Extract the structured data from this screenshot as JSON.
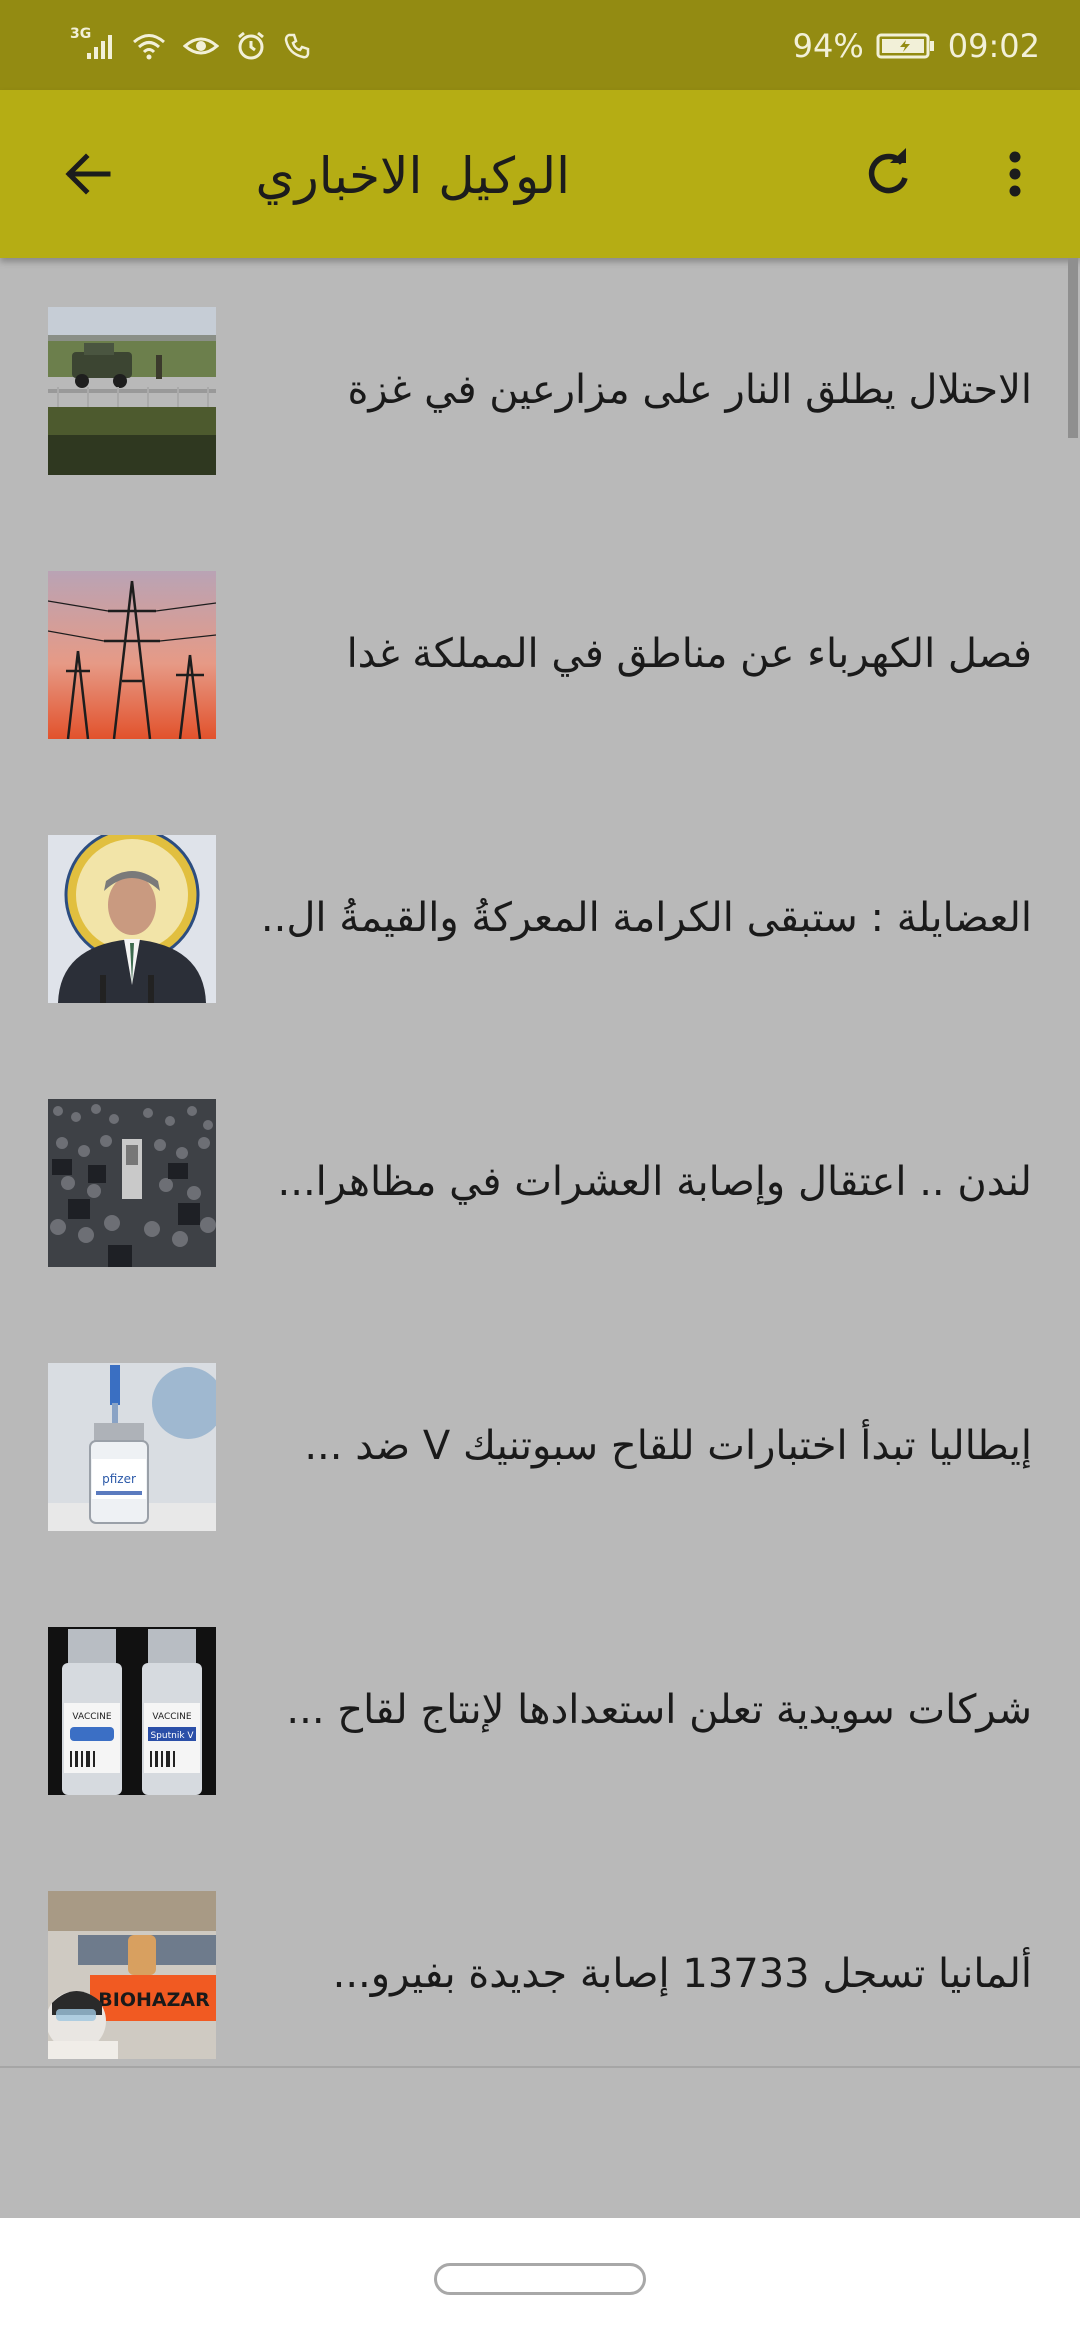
{
  "status_bar": {
    "network_label": "3G",
    "battery_percent": "94%",
    "time": "09:02",
    "icons": [
      "signal-icon",
      "wifi-icon",
      "eye-icon",
      "alarm-icon",
      "phone-icon",
      "battery-icon"
    ]
  },
  "app_bar": {
    "title": "الوكيل الاخباري",
    "back_icon": "arrow-left-icon",
    "refresh_icon": "refresh-icon",
    "menu_icon": "more-vertical-icon"
  },
  "colors": {
    "status_bar": "#938b12",
    "app_bar": "#b5ad14",
    "list_background": "#b9b9b9",
    "nav_bar": "#ffffff"
  },
  "news": [
    {
      "title": "الاحتلال يطلق النار على مزارعين في غزة",
      "thumbnail": "military-vehicle-thumbnail"
    },
    {
      "title": "فصل الكهرباء عن مناطق في المملكة غدا",
      "thumbnail": "power-towers-thumbnail"
    },
    {
      "title": "العضايلة : ستبقى الكرامة المعركةُ والقيمةُ ال...",
      "thumbnail": "speaker-podium-thumbnail"
    },
    {
      "title": "لندن .. اعتقال وإصابة العشرات في مظاهرا...",
      "thumbnail": "crowd-protest-thumbnail"
    },
    {
      "title": "إيطاليا تبدأ اختبارات للقاح سبوتنيك V ضد ...",
      "thumbnail": "vaccine-vial-thumbnail"
    },
    {
      "title": "شركات سويدية تعلن استعدادها لإنتاج لقاح ...",
      "thumbnail": "vaccine-bottles-thumbnail"
    },
    {
      "title": "ألمانيا تسجل 13733 إصابة جديدة بفيرو...",
      "thumbnail": "biohazard-lab-thumbnail",
      "thumbnail_text": "BIOHAZAR"
    }
  ],
  "thumb_labels": {
    "vial_brand": "pfizer",
    "vaccine_a": "VACCINE",
    "vaccine_b": "VACCINE",
    "sputnik": "Sputnik V"
  }
}
